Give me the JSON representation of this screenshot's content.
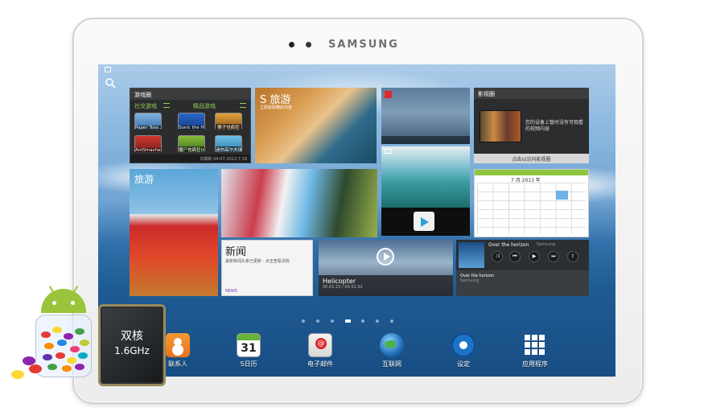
{
  "device": {
    "brand": "SAMSUNG"
  },
  "widgets": {
    "game_hub": {
      "title": "游戏圈",
      "social_label": "社交游戏",
      "premium_label": "精品游戏",
      "tiles": [
        "Paper Toss...",
        "Sonic the He...",
        "猴子也疯狂",
        "AntSmasher",
        "僵尸也疯狂UP",
        "迷你高尔夫球"
      ],
      "footer": "日期新 04-07-2013 7:18"
    },
    "travel_1": {
      "title": "S 旅游",
      "subtitle": "立即获取精彩内容"
    },
    "video_hub": {
      "title": "影视圈",
      "text": "您的设备上暂时没有可观看的视频内容",
      "button": "点击以访问影视圈"
    },
    "calendar": {
      "month": "7 月 2013 年"
    },
    "travel_2": {
      "title": "旅游"
    },
    "news": {
      "title": "新闻",
      "subtitle": "最新新闻头条已更新 · 点击查看详情",
      "footer": "NEWS"
    },
    "video_player": {
      "title": "Helicopter",
      "time": "00:01:15 / 00:01:32"
    },
    "music_player": {
      "song": "Over the horizon",
      "artist": "Samsung",
      "lower_song": "Over the horizon",
      "lower_artist": "Samsung"
    }
  },
  "dock": {
    "contacts": "联系人",
    "s_planner": "S日历",
    "s_planner_date": "31",
    "email": "电子邮件",
    "internet": "互联网",
    "settings": "设定",
    "apps": "应用程序"
  },
  "badge": {
    "line1": "双核",
    "line2": "1.6GHz"
  },
  "colors": {
    "accent_green": "#8cc63f",
    "android_green": "#9ac53b",
    "sea_blue": "#1f5b93"
  },
  "icons": [
    "search-icon",
    "gallery-icon",
    "flipboard-icon",
    "play-store-icon",
    "contacts-icon",
    "calendar-icon",
    "email-icon",
    "globe-icon",
    "settings-icon",
    "apps-grid-icon"
  ]
}
